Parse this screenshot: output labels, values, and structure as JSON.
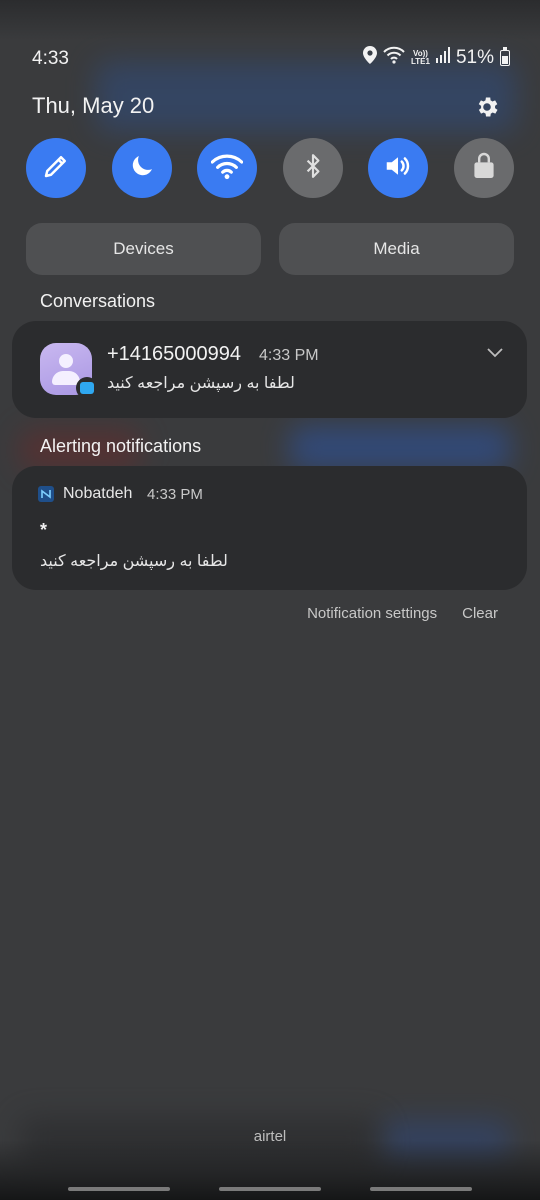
{
  "status_bar": {
    "time": "4:33",
    "volte_top": "Vo))",
    "volte_bottom": "LTE1",
    "battery": "51%",
    "battery_level": 0.51
  },
  "header": {
    "date": "Thu, May 20"
  },
  "quick_toggles": [
    {
      "name": "edit",
      "icon": "pencil-icon",
      "state": "on"
    },
    {
      "name": "dark-mode",
      "icon": "moon-icon",
      "state": "on"
    },
    {
      "name": "wifi",
      "icon": "wifi-icon",
      "state": "on"
    },
    {
      "name": "bluetooth",
      "icon": "bluetooth-icon",
      "state": "off"
    },
    {
      "name": "sound",
      "icon": "speaker-icon",
      "state": "on"
    },
    {
      "name": "secure-folder",
      "icon": "lock-icon",
      "state": "off"
    }
  ],
  "panels": {
    "devices": "Devices",
    "media": "Media"
  },
  "conversations": {
    "title": "Conversations",
    "item": {
      "sender": "+14165000994",
      "time": "4:33 PM",
      "message": "لطفا به رسپشن مراجعه کنید"
    }
  },
  "alerting": {
    "title": "Alerting notifications",
    "item": {
      "app": "Nobatdeh",
      "time": "4:33 PM",
      "heading": "*",
      "message": "لطفا به رسپشن مراجعه کنید"
    }
  },
  "actions": {
    "settings": "Notification settings",
    "clear": "Clear"
  },
  "carrier": "airtel",
  "colors": {
    "accent": "#3a7bf2",
    "toggle_off": "#6a6b6d",
    "card": "#2b2c2e",
    "background": "#3a3b3d"
  }
}
